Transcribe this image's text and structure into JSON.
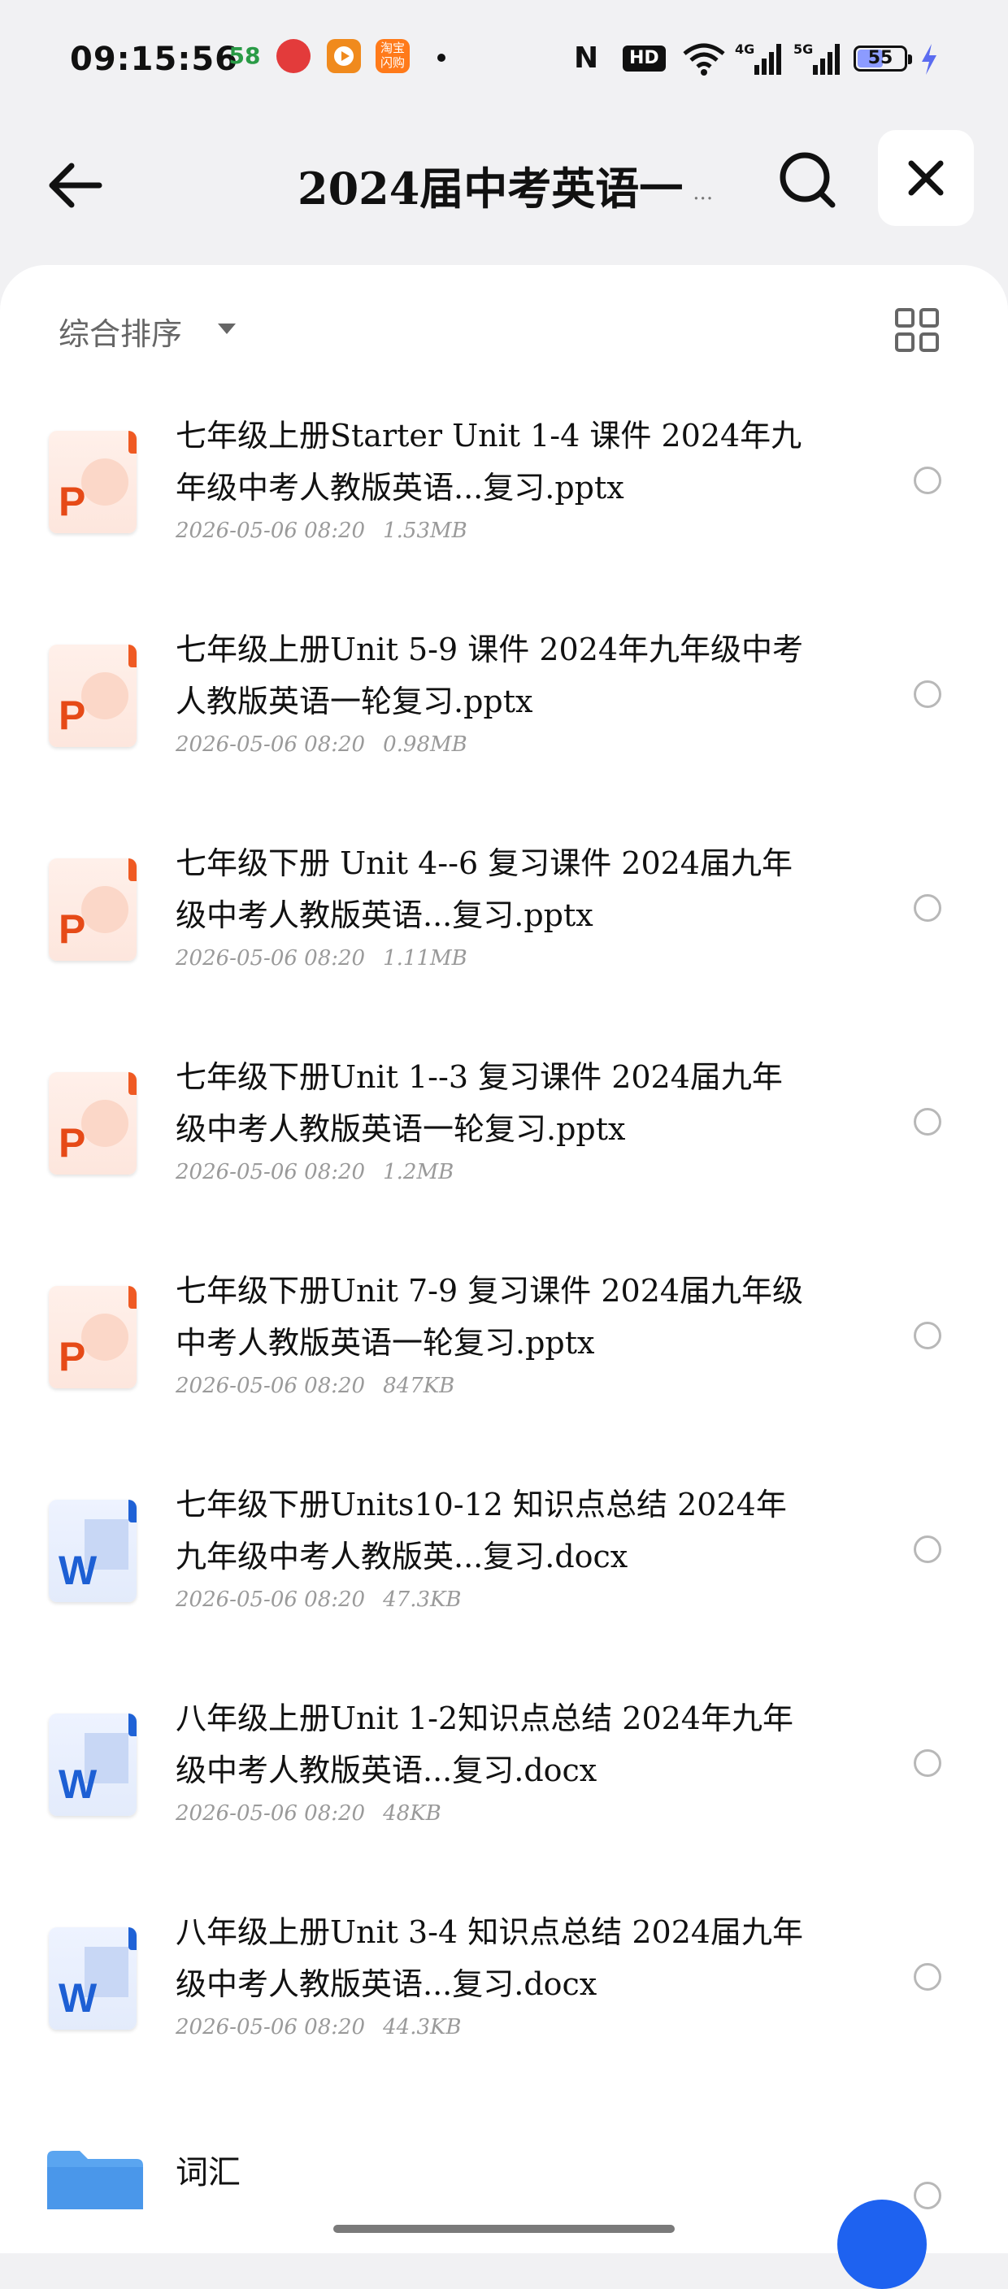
{
  "status_bar": {
    "time": "09:15:56",
    "app_58": "58",
    "taobao_badge": "淘宝\n闪购",
    "nfc": "N",
    "hd": "HD",
    "net_4g": "4G",
    "net_5g": "5G",
    "battery": "55",
    "battery_fraction": 0.55
  },
  "header": {
    "title": "2024届中考英语一",
    "ellipsis": "...",
    "icons": [
      "back-arrow-icon",
      "search-icon",
      "close-icon"
    ]
  },
  "sort": {
    "label": "综合排序",
    "view_icon": "grid-view-icon"
  },
  "files": [
    {
      "type": "ppt",
      "name": "七年级上册Starter Unit 1-4 课件 2024年九年级中考人教版英语...复习.pptx",
      "date": "2026-05-06 08:20",
      "size": "1.53MB"
    },
    {
      "type": "ppt",
      "name": "七年级上册Unit 5-9 课件 2024年九年级中考人教版英语一轮复习.pptx",
      "date": "2026-05-06 08:20",
      "size": "0.98MB"
    },
    {
      "type": "ppt",
      "name": "七年级下册 Unit 4--6 复习课件 2024届九年级中考人教版英语...复习.pptx",
      "date": "2026-05-06 08:20",
      "size": "1.11MB"
    },
    {
      "type": "ppt",
      "name": "七年级下册Unit 1--3 复习课件 2024届九年级中考人教版英语一轮复习.pptx",
      "date": "2026-05-06 08:20",
      "size": "1.2MB"
    },
    {
      "type": "ppt",
      "name": "七年级下册Unit 7-9 复习课件 2024届九年级中考人教版英语一轮复习.pptx",
      "date": "2026-05-06 08:20",
      "size": "847KB"
    },
    {
      "type": "doc",
      "name": "七年级下册Units10-12 知识点总结 2024年九年级中考人教版英...复习.docx",
      "date": "2026-05-06 08:20",
      "size": "47.3KB"
    },
    {
      "type": "doc",
      "name": "八年级上册Unit 1-2知识点总结 2024年九年级中考人教版英语...复习.docx",
      "date": "2026-05-06 08:20",
      "size": "48KB"
    },
    {
      "type": "doc",
      "name": "八年级上册Unit 3-4 知识点总结 2024届九年级中考人教版英语...复习.docx",
      "date": "2026-05-06 08:20",
      "size": "44.3KB"
    }
  ],
  "file_letters": {
    "ppt": "P",
    "doc": "W"
  },
  "folder": {
    "name": "词汇"
  },
  "colors": {
    "ppt_accent": "#e64a17",
    "doc_accent": "#1d5fd4",
    "fab": "#1e62f0",
    "battery": "#8c9bff"
  }
}
